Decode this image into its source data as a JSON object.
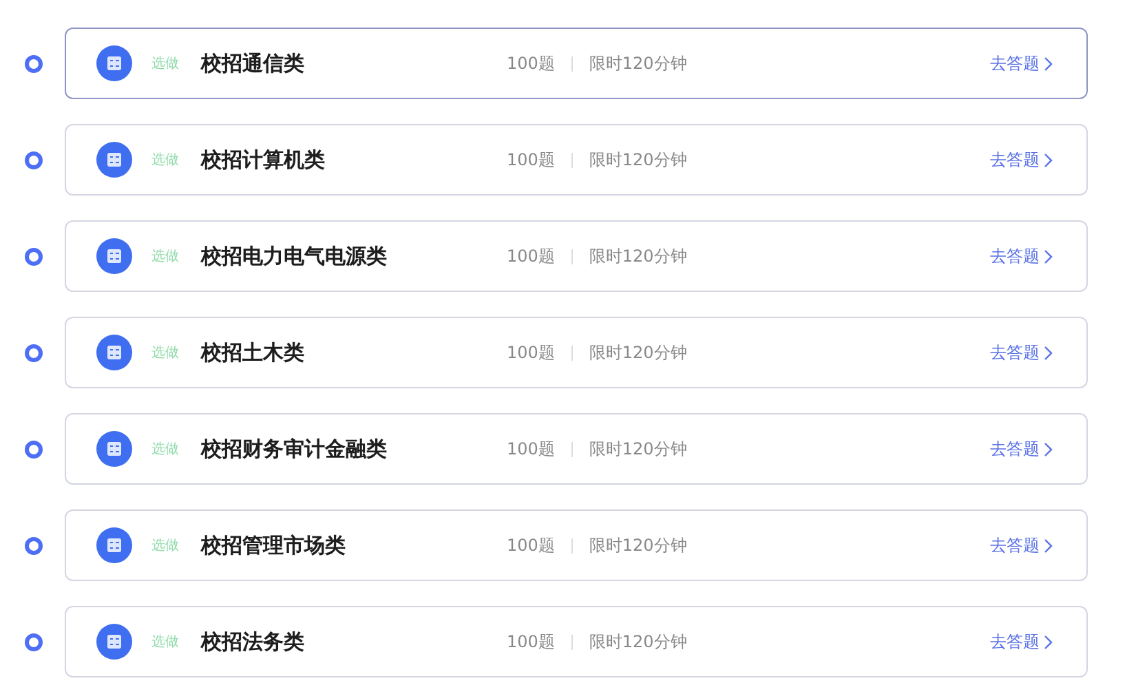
{
  "items": [
    {
      "tag": "选做",
      "title": "校招通信类",
      "count": "100题",
      "limit": "限时120分钟",
      "action": "去答题",
      "selected": true
    },
    {
      "tag": "选做",
      "title": "校招计算机类",
      "count": "100题",
      "limit": "限时120分钟",
      "action": "去答题",
      "selected": false
    },
    {
      "tag": "选做",
      "title": "校招电力电气电源类",
      "count": "100题",
      "limit": "限时120分钟",
      "action": "去答题",
      "selected": false
    },
    {
      "tag": "选做",
      "title": "校招土木类",
      "count": "100题",
      "limit": "限时120分钟",
      "action": "去答题",
      "selected": false
    },
    {
      "tag": "选做",
      "title": "校招财务审计金融类",
      "count": "100题",
      "limit": "限时120分钟",
      "action": "去答题",
      "selected": false
    },
    {
      "tag": "选做",
      "title": "校招管理市场类",
      "count": "100题",
      "limit": "限时120分钟",
      "action": "去答题",
      "selected": false
    },
    {
      "tag": "选做",
      "title": "校招法务类",
      "count": "100题",
      "limit": "限时120分钟",
      "action": "去答题",
      "selected": false
    }
  ]
}
